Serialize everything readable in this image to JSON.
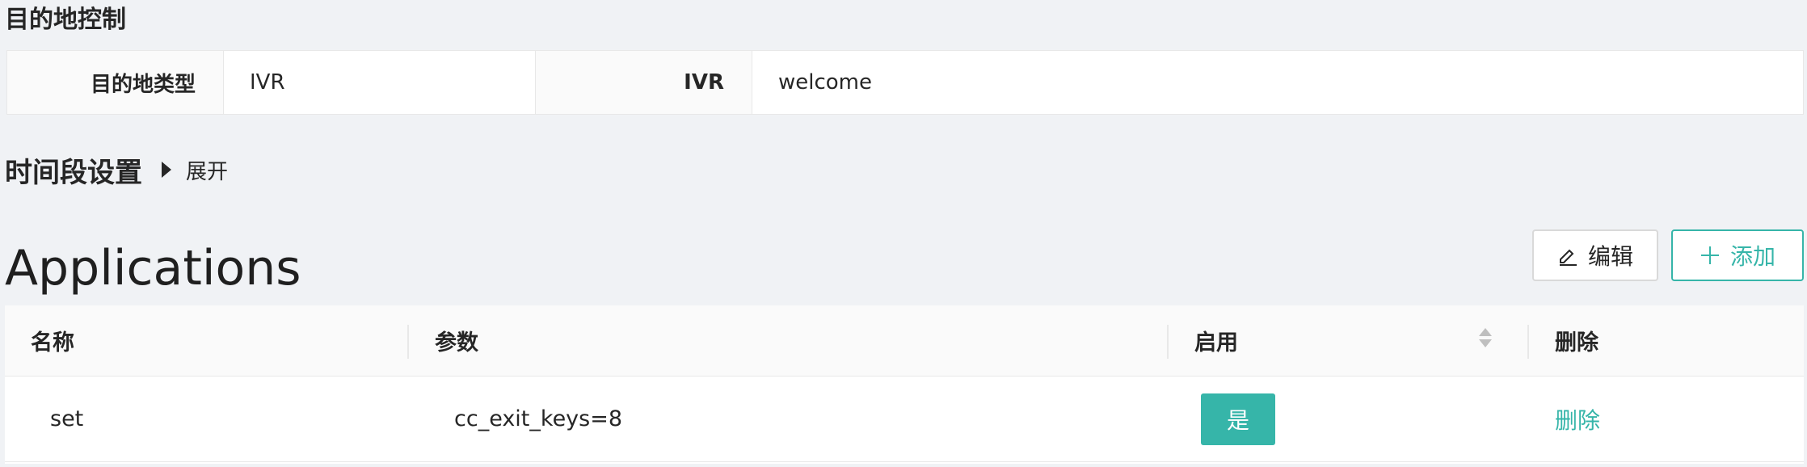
{
  "destination": {
    "title": "目的地控制",
    "type_label": "目的地类型",
    "type_value": "IVR",
    "ivr_label": "IVR",
    "ivr_value": "welcome"
  },
  "time": {
    "title": "时间段设置",
    "expand_label": "展开"
  },
  "applications": {
    "title": "Applications",
    "edit_label": "编辑",
    "add_label": "添加",
    "columns": [
      "名称",
      "参数",
      "启用",
      "删除"
    ],
    "rows": [
      {
        "name": "set",
        "params": "cc_exit_keys=8",
        "enabled": "是",
        "delete": "删除"
      }
    ]
  },
  "colors": {
    "accent": "#36b5a9"
  },
  "icons": {
    "edit": "edit-icon",
    "add": "plus-icon",
    "expand": "caret-right-icon",
    "sort": "sort-icon"
  }
}
